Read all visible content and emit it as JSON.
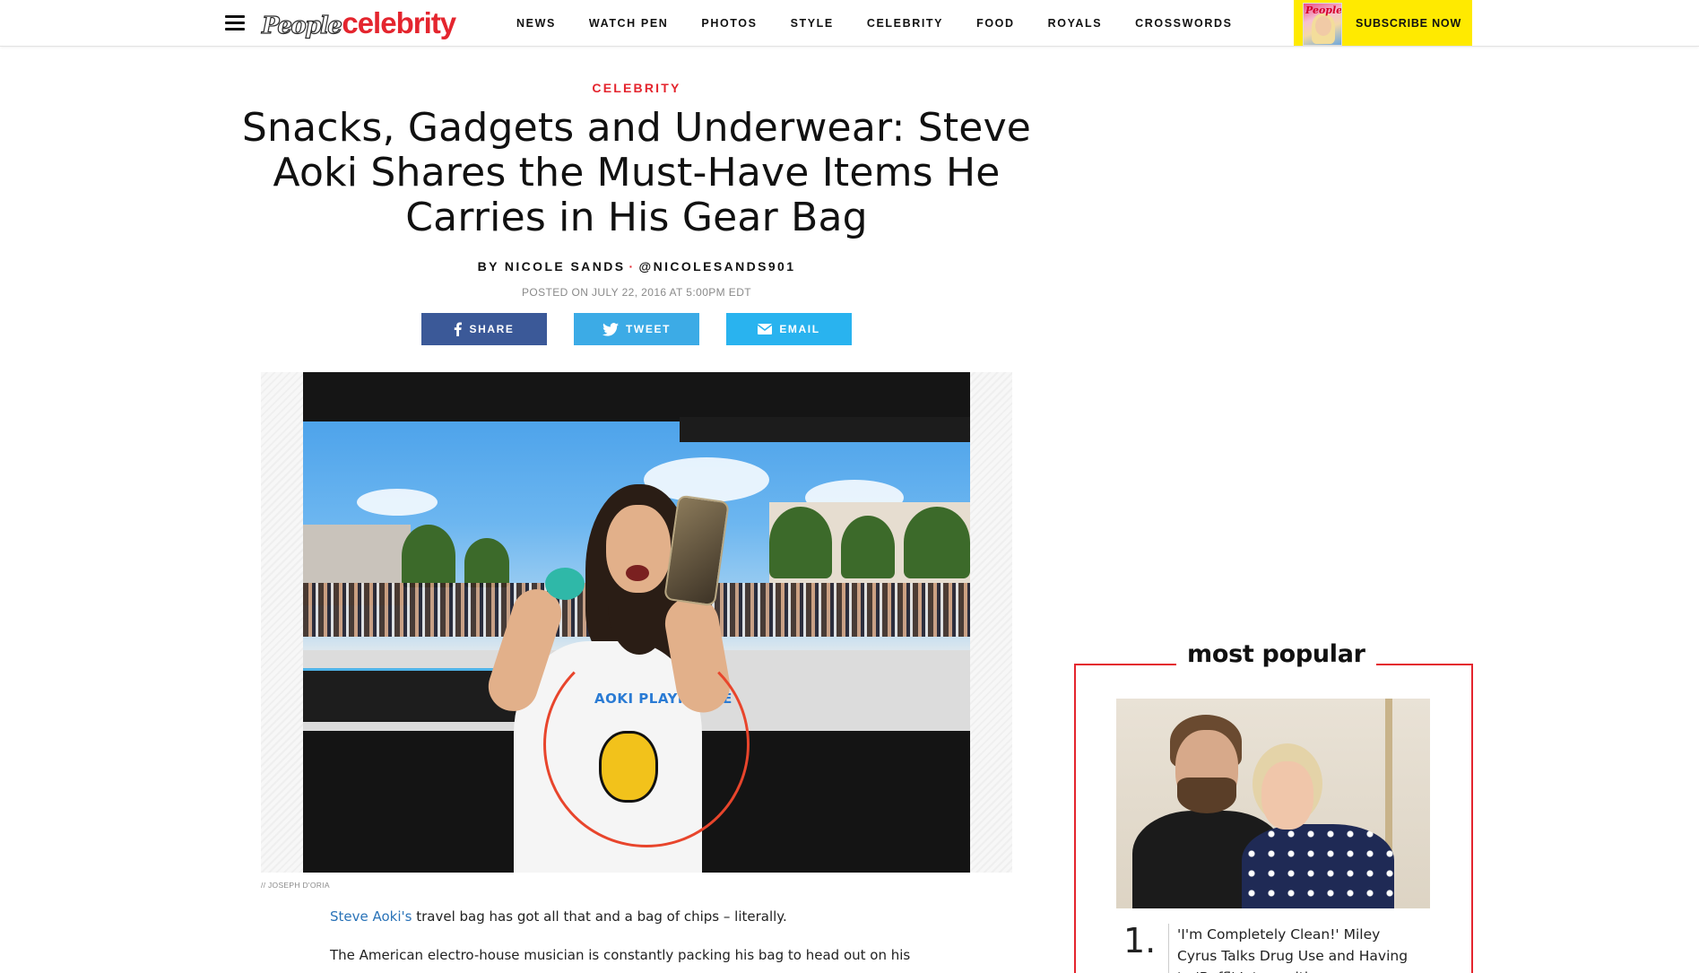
{
  "header": {
    "logo_people": "People",
    "logo_celebrity": "celebrity",
    "nav": [
      "NEWS",
      "WATCH PEN",
      "PHOTOS",
      "STYLE",
      "CELEBRITY",
      "FOOD",
      "ROYALS",
      "CROSSWORDS"
    ],
    "subscribe_label": "SUBSCRIBE NOW",
    "magazine_title": "People"
  },
  "article": {
    "kicker": "CELEBRITY",
    "headline": "Snacks, Gadgets and Underwear: Steve Aoki Shares the Must-Have Items He Carries in His Gear Bag",
    "byline_author": "BY NICOLE SANDS",
    "byline_handle": "@NICOLESANDS901",
    "posted": "POSTED ON JULY 22, 2016 AT 5:00PM EDT",
    "share": {
      "facebook": "SHARE",
      "twitter": "TWEET",
      "email": "EMAIL"
    },
    "photo_credit": "// JOSEPH D'ORIA",
    "hero_tank_text": "AOKI PLAYHOUSE",
    "p1_link": "Steve Aoki's",
    "p1_rest": " travel bag has got all that and a bag of chips – literally.",
    "p2": "The American electro-house musician is constantly packing his bag to head out on his"
  },
  "most_popular": {
    "title": "most popular",
    "items": [
      {
        "number": "1.",
        "text": "'I'm Completely Clean!' Miley Cyrus Talks Drug Use and Having to 'Buffl' Into... with"
      }
    ]
  },
  "colors": {
    "accent_red": "#e4252e",
    "facebook": "#3b5998",
    "twitter": "#3cabe6",
    "email": "#29b3ef",
    "subscribe_bg": "#ffea00",
    "link": "#2a73b8"
  },
  "icons": {
    "menu": "hamburger-icon",
    "facebook": "facebook-icon",
    "twitter": "twitter-icon",
    "email": "envelope-icon"
  }
}
